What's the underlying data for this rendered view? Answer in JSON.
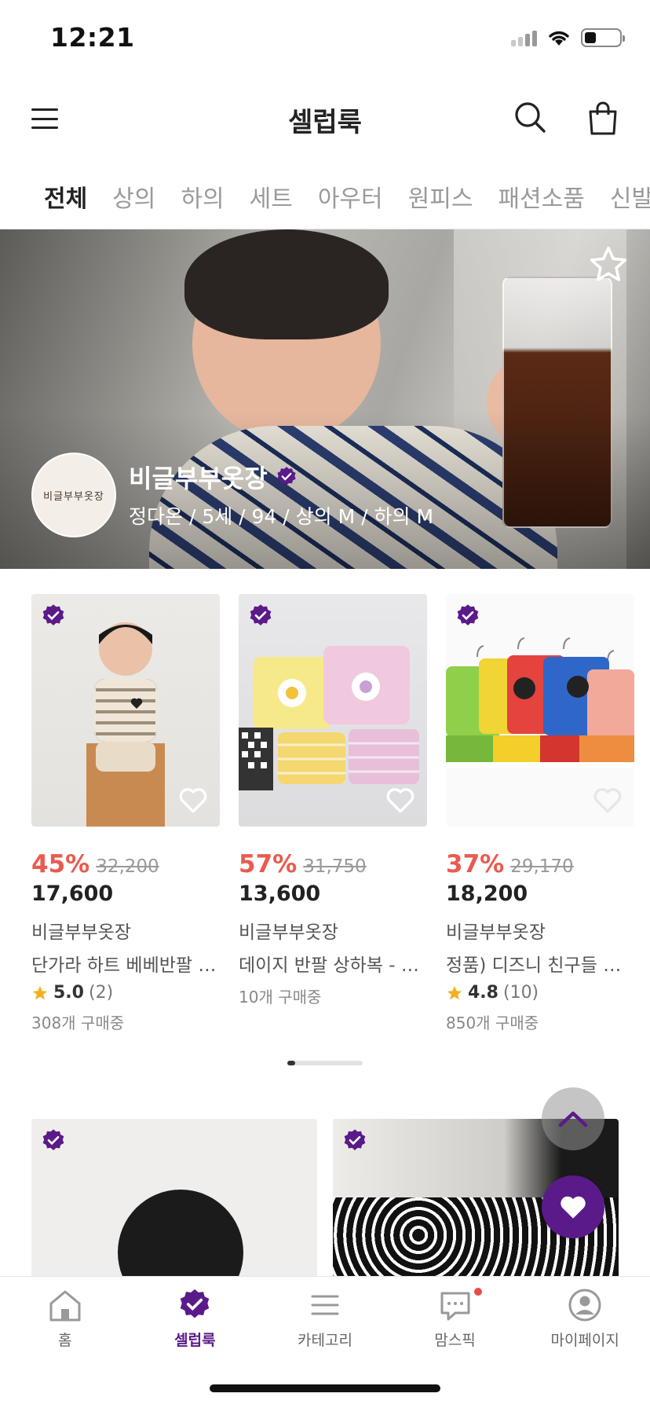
{
  "status_bar": {
    "time": "12:21"
  },
  "header": {
    "title": "셀럽룩"
  },
  "tabs": [
    "전체",
    "상의",
    "하의",
    "세트",
    "아우터",
    "원피스",
    "패션소품",
    "신발"
  ],
  "banner": {
    "seller_name": "비글부부옷장",
    "seller_info": "정다온 / 5세 / 94 / 상의 M / 하의 M",
    "avatar_text": "비글부부옷장"
  },
  "products": [
    {
      "discount": "45%",
      "original_price": "32,200",
      "price": "17,600",
      "seller": "비글부부옷장",
      "name": "단가라 하트 베베반팔 세트",
      "rating": "5.0",
      "review_count": "(2)",
      "buying": "308개 구매중"
    },
    {
      "discount": "57%",
      "original_price": "31,750",
      "price": "13,600",
      "seller": "비글부부옷장",
      "name": "데이지 반팔 상하복 - M...",
      "rating": "",
      "review_count": "",
      "buying": "10개 구매중"
    },
    {
      "discount": "37%",
      "original_price": "29,170",
      "price": "18,200",
      "seller": "비글부부옷장",
      "name": "정품) 디즈니 친구들 반...",
      "rating": "4.8",
      "review_count": "(10)",
      "buying": "850개 구매중"
    }
  ],
  "carousel": {
    "page": 1
  },
  "bottom_nav": [
    {
      "label": "홈",
      "icon": "home-icon"
    },
    {
      "label": "셀럽룩",
      "icon": "verified-badge-icon"
    },
    {
      "label": "카테고리",
      "icon": "list-icon"
    },
    {
      "label": "맘스픽",
      "icon": "chat-icon"
    },
    {
      "label": "마이페이지",
      "icon": "user-icon"
    }
  ],
  "colors": {
    "accent": "#5b1a8a",
    "discount": "#ea5a4f",
    "star": "#f2b01e"
  }
}
